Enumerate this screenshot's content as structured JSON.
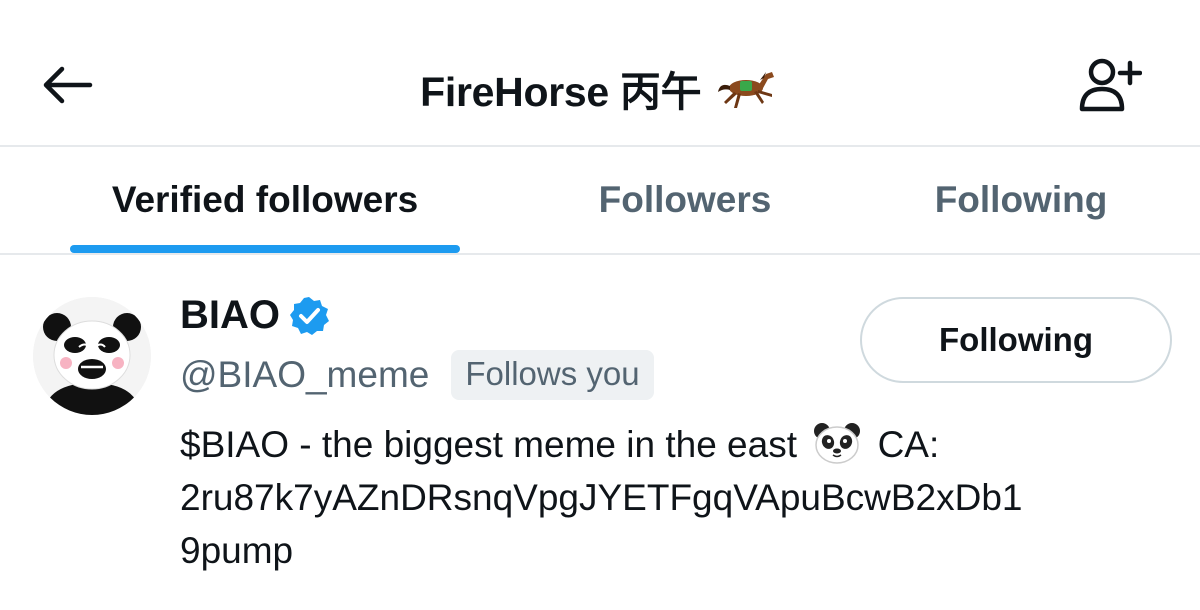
{
  "header": {
    "back_icon": "arrow-left-icon",
    "title": "FireHorse 丙午",
    "title_emoji_icon": "running-horse-icon",
    "add_user_icon": "add-user-icon"
  },
  "tabs": [
    {
      "label": "Verified followers",
      "active": true
    },
    {
      "label": "Followers",
      "active": false
    },
    {
      "label": "Following",
      "active": false
    }
  ],
  "user": {
    "name": "BIAO",
    "verified_icon": "verified-badge-icon",
    "handle": "@BIAO_meme",
    "follows_you": "Follows you",
    "follow_button": "Following",
    "bio_part1": "$BIAO - the biggest meme in the east",
    "bio_emoji_icon": "panda-face-icon",
    "bio_part2": "CA:",
    "bio_line2": "2ru87k7yAZnDRsnqVpgJYETFgqVApuBcwB2xDb1",
    "bio_line3": "9pump"
  },
  "colors": {
    "accent": "#1d9bf0",
    "text_primary": "#0f1419",
    "text_secondary": "#536471",
    "divider": "#e6e9ec"
  }
}
